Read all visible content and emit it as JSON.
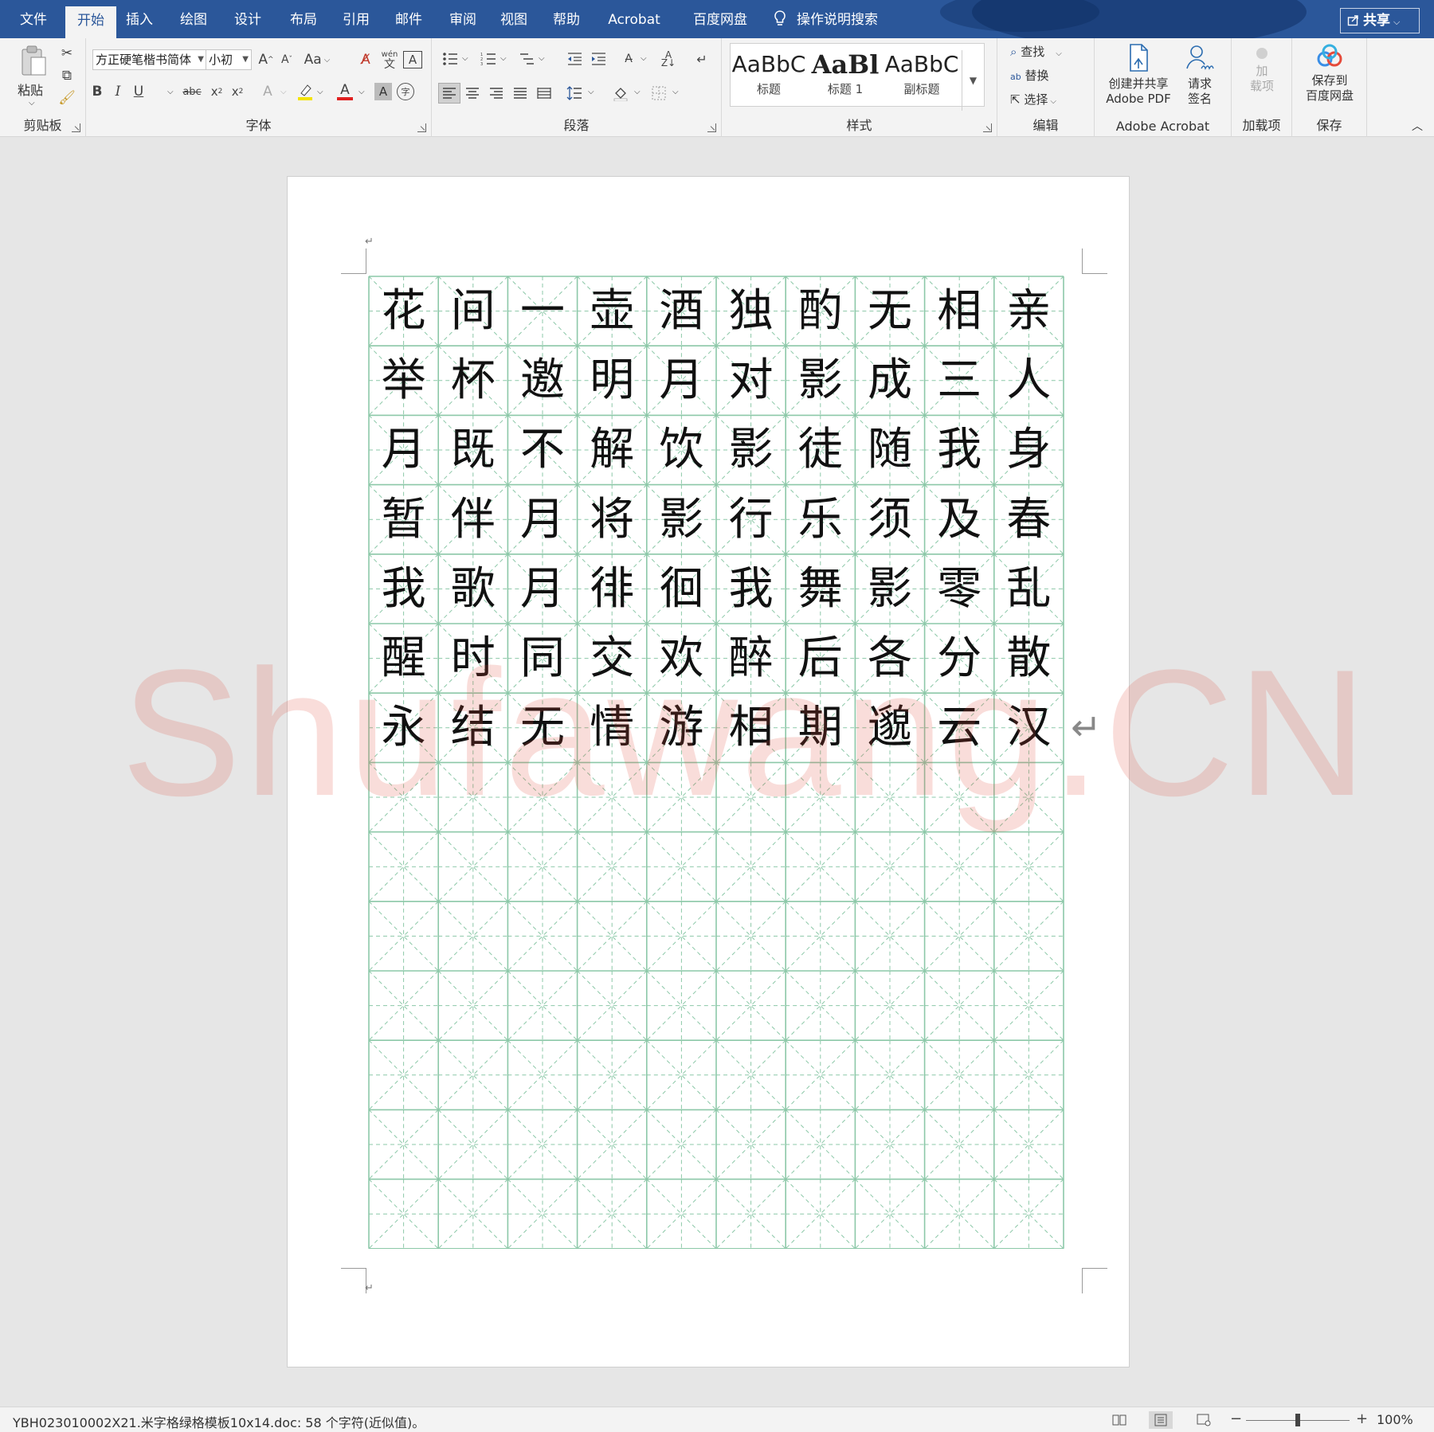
{
  "tabs": [
    {
      "id": "file",
      "label": "文件"
    },
    {
      "id": "home",
      "label": "开始",
      "active": true
    },
    {
      "id": "insert",
      "label": "插入"
    },
    {
      "id": "draw",
      "label": "绘图"
    },
    {
      "id": "design",
      "label": "设计"
    },
    {
      "id": "layout",
      "label": "布局"
    },
    {
      "id": "references",
      "label": "引用"
    },
    {
      "id": "mailings",
      "label": "邮件"
    },
    {
      "id": "review",
      "label": "审阅"
    },
    {
      "id": "view",
      "label": "视图"
    },
    {
      "id": "help",
      "label": "帮助"
    },
    {
      "id": "acrobat",
      "label": "Acrobat"
    },
    {
      "id": "baidu",
      "label": "百度网盘"
    }
  ],
  "tell_me": "操作说明搜索",
  "share": "共享",
  "ribbon": {
    "clipboard": {
      "paste": "粘贴",
      "label": "剪贴板"
    },
    "font": {
      "font_name": "方正硬笔楷书简体",
      "font_size": "小初",
      "change_case": "Aa",
      "phonetic_top": "wén",
      "phonetic_bottom": "文",
      "label": "字体"
    },
    "paragraph": {
      "label": "段落"
    },
    "styles": {
      "items": [
        {
          "sample": "AaBbC",
          "name": "标题"
        },
        {
          "sample": "AaBl",
          "name": "标题 1"
        },
        {
          "sample": "AaBbC",
          "name": "副标题"
        }
      ],
      "label": "样式"
    },
    "editing": {
      "find": "查找",
      "replace": "替换",
      "select": "选择",
      "label": "编辑"
    },
    "acrobat": {
      "create_line1": "创建并共享",
      "create_line2": "Adobe PDF",
      "sign_line1": "请求",
      "sign_line2": "签名",
      "label": "Adobe Acrobat"
    },
    "addins": {
      "line1": "加",
      "line2": "载项",
      "label": "加载项"
    },
    "save": {
      "line1": "保存到",
      "line2": "百度网盘",
      "label": "保存"
    }
  },
  "document": {
    "rows": [
      "花间一壶酒独酌无相亲",
      "举杯邀明月对影成三人",
      "月既不解饮影徒随我身",
      "暂伴月将影行乐须及春",
      "我歌月徘徊我舞影零乱",
      "醒时同交欢醉后各分散",
      "永结无情游相期邈云汉"
    ],
    "grid_columns": 10,
    "grid_rows": 14,
    "grid_color": "#8cc8a8"
  },
  "watermark": "Shufawang.CN",
  "status": {
    "text": "YBH023010002X21.米字格绿格模板10x14.doc: 58 个字符(近似值)。",
    "zoom": "100%",
    "zoom_fraction": 0.5
  },
  "colors": {
    "title_bar": "#2b579a",
    "ribbon": "#f3f3f3",
    "canvas": "#e6e6e6",
    "watermark": "#e04a3a"
  }
}
